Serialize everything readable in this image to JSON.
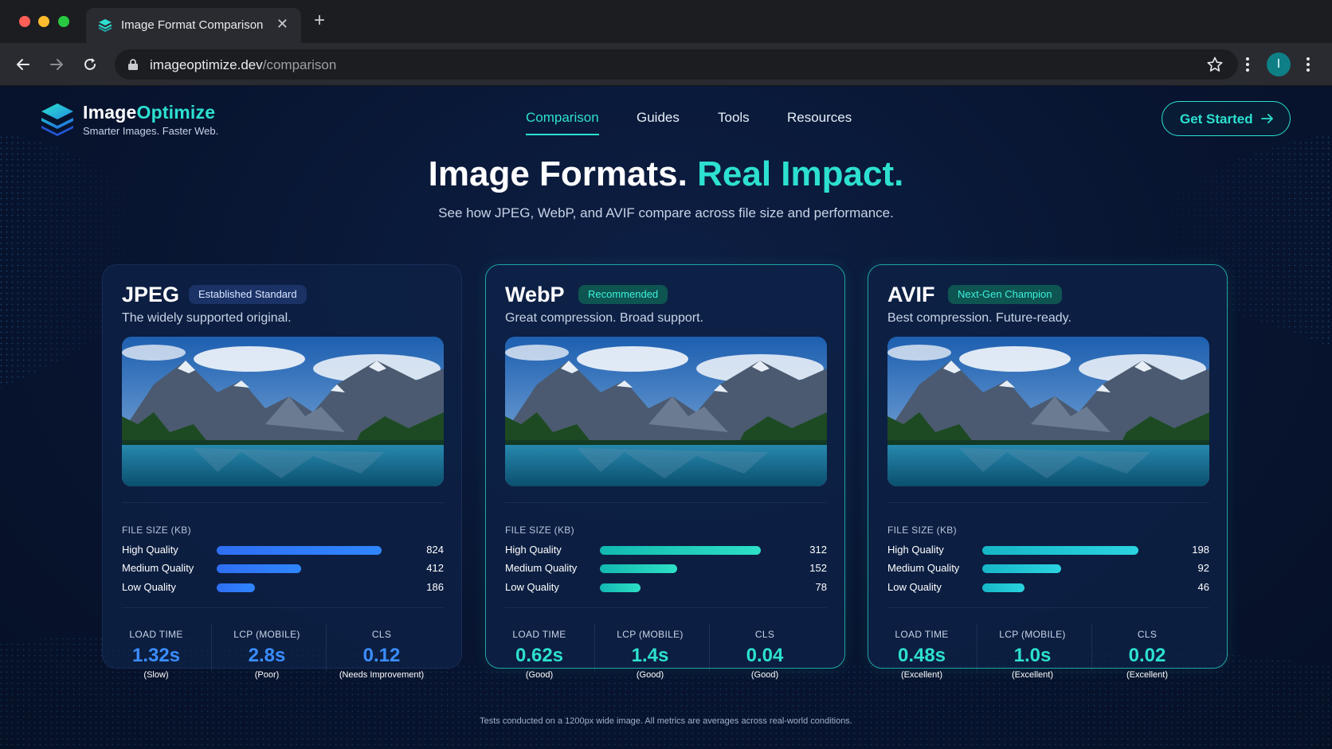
{
  "browser": {
    "tab_title": "Image Format Comparison",
    "url_host": "imageoptimize.dev",
    "url_path": "/comparison",
    "profile_initial": "I"
  },
  "header": {
    "brand_prefix": "Image",
    "brand_accent": "Optimize",
    "tagline": "Smarter Images. Faster Web.",
    "nav": [
      "Comparison",
      "Guides",
      "Tools",
      "Resources"
    ],
    "active_nav": "Comparison",
    "cta_label": "Get Started"
  },
  "hero": {
    "title_main": "Image Formats.",
    "title_accent": "Real Impact.",
    "subtitle": "See how JPEG, WebP, and AVIF compare across file size and performance."
  },
  "file_size_label": "FILE SIZE (KB)",
  "quality_labels": [
    "High Quality",
    "Medium Quality",
    "Low Quality"
  ],
  "metric_labels": [
    "LOAD TIME",
    "LCP (MOBILE)",
    "CLS"
  ],
  "cards": [
    {
      "name": "JPEG",
      "badge": "Established Standard",
      "description": "The widely supported original.",
      "sizes": [
        824,
        412,
        186
      ],
      "metrics": [
        {
          "value": "1.32s",
          "note": "(Slow)"
        },
        {
          "value": "2.8s",
          "note": "(Poor)"
        },
        {
          "value": "0.12",
          "note": "(Needs Improvement)"
        }
      ]
    },
    {
      "name": "WebP",
      "badge": "Recommended",
      "description": "Great compression. Broad support.",
      "sizes": [
        312,
        152,
        78
      ],
      "metrics": [
        {
          "value": "0.62s",
          "note": "(Good)"
        },
        {
          "value": "1.4s",
          "note": "(Good)"
        },
        {
          "value": "0.04",
          "note": "(Good)"
        }
      ]
    },
    {
      "name": "AVIF",
      "badge": "Next-Gen Champion",
      "description": "Best compression. Future-ready.",
      "sizes": [
        198,
        92,
        46
      ],
      "metrics": [
        {
          "value": "0.48s",
          "note": "(Excellent)"
        },
        {
          "value": "1.0s",
          "note": "(Excellent)"
        },
        {
          "value": "0.02",
          "note": "(Excellent)"
        }
      ]
    }
  ],
  "bar_fill_fractions": [
    [
      0.9,
      0.46,
      0.21
    ],
    [
      0.88,
      0.42,
      0.22
    ],
    [
      0.85,
      0.43,
      0.23
    ]
  ],
  "colors": {
    "accent_teal": "#2de0d0",
    "jpeg_blue": "#2f7bf8",
    "background": "#081531"
  },
  "footnote": "Tests conducted on a 1200px wide image. All metrics are averages across real-world conditions."
}
